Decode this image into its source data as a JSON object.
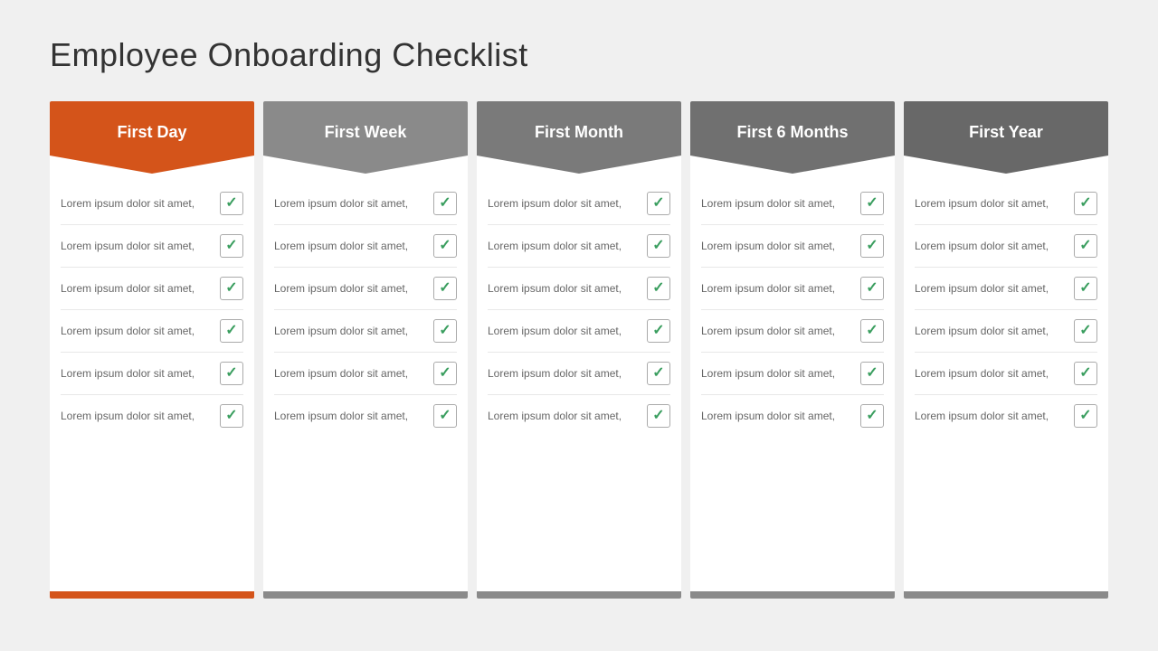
{
  "title": "Employee  Onboarding Checklist",
  "columns": [
    {
      "id": "first-day",
      "label": "First Day",
      "headerClass": "orange",
      "footerClass": "orange",
      "items": [
        {
          "text": "Lorem ipsum dolor sit amet,"
        },
        {
          "text": "Lorem ipsum dolor sit amet,"
        },
        {
          "text": "Lorem ipsum dolor sit amet,"
        },
        {
          "text": "Lorem ipsum dolor sit amet,"
        },
        {
          "text": "Lorem ipsum dolor sit amet,"
        },
        {
          "text": "Lorem ipsum dolor sit amet,"
        }
      ]
    },
    {
      "id": "first-week",
      "label": "First Week",
      "headerClass": "gray1",
      "footerClass": "gray",
      "items": [
        {
          "text": "Lorem ipsum dolor sit amet,"
        },
        {
          "text": "Lorem ipsum dolor sit amet,"
        },
        {
          "text": "Lorem ipsum dolor sit amet,"
        },
        {
          "text": "Lorem ipsum dolor sit amet,"
        },
        {
          "text": "Lorem ipsum dolor sit amet,"
        },
        {
          "text": "Lorem ipsum dolor sit amet,"
        }
      ]
    },
    {
      "id": "first-month",
      "label": "First Month",
      "headerClass": "gray2",
      "footerClass": "gray",
      "items": [
        {
          "text": "Lorem ipsum dolor sit amet,"
        },
        {
          "text": "Lorem ipsum dolor sit amet,"
        },
        {
          "text": "Lorem ipsum dolor sit amet,"
        },
        {
          "text": "Lorem ipsum dolor sit amet,"
        },
        {
          "text": "Lorem ipsum dolor sit amet,"
        },
        {
          "text": "Lorem ipsum dolor sit amet,"
        }
      ]
    },
    {
      "id": "first-6-months",
      "label": "First 6 Months",
      "headerClass": "gray3",
      "footerClass": "gray",
      "items": [
        {
          "text": "Lorem ipsum dolor sit amet,"
        },
        {
          "text": "Lorem ipsum dolor sit amet,"
        },
        {
          "text": "Lorem ipsum dolor sit amet,"
        },
        {
          "text": "Lorem ipsum dolor sit amet,"
        },
        {
          "text": "Lorem ipsum dolor sit amet,"
        },
        {
          "text": "Lorem ipsum dolor sit amet,"
        }
      ]
    },
    {
      "id": "first-year",
      "label": "First Year",
      "headerClass": "gray4",
      "footerClass": "gray",
      "items": [
        {
          "text": "Lorem ipsum dolor sit amet,"
        },
        {
          "text": "Lorem ipsum dolor sit amet,"
        },
        {
          "text": "Lorem ipsum dolor sit amet,"
        },
        {
          "text": "Lorem ipsum dolor sit amet,"
        },
        {
          "text": "Lorem ipsum dolor sit amet,"
        },
        {
          "text": "Lorem ipsum dolor sit amet,"
        }
      ]
    }
  ],
  "checkmark": "✓"
}
